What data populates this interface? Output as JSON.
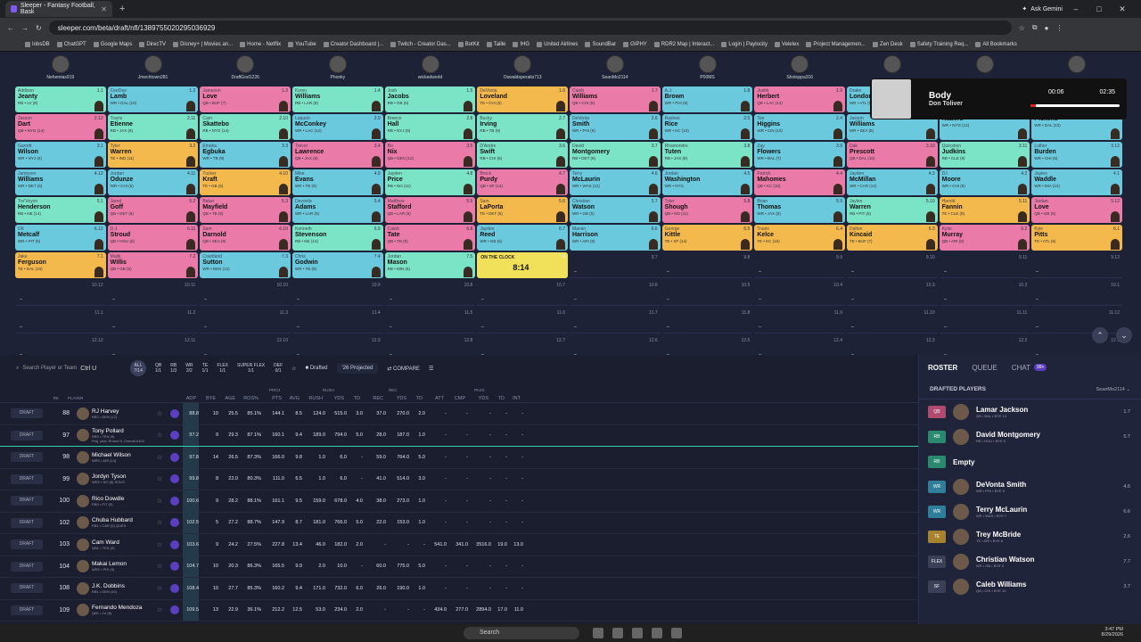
{
  "browser": {
    "tab_title": "Sleeper - Fantasy Football, Bask",
    "url": "sleeper.com/beta/draft/nfl/1389755020295036929",
    "ask_gemini": "Ask Gemini"
  },
  "bookmarks": [
    "IobsDB",
    "ChatGPT",
    "Google Maps",
    "DirecTV",
    "Disney+ | Movies an...",
    "Home - Netflix",
    "YouTube",
    "Creator Dashboard |...",
    "Twitch - Creator Das...",
    "BotKit",
    "Taille",
    "IHG",
    "United Airlines",
    "SoundBar",
    "GIPHY",
    "RDR2 Map | Interact...",
    "Login | Paylocity",
    "Velelex",
    "Project Managemen...",
    "Zen Desk",
    "Safety Training Req...",
    "All Bookmarks"
  ],
  "managers": [
    "Nehemias919",
    "Jmechtown281",
    "DraftGod1226",
    "Phonky",
    "wickedworld",
    "Oswaldoperalts713",
    "SeanMo2114",
    "P00MS",
    "Shotoppa316",
    "",
    "",
    ""
  ],
  "board": [
    [
      [
        "Addison",
        "Jeanty",
        "RB • LV (8)",
        "1.1",
        "RB"
      ],
      [
        "CeeDee",
        "Lamb",
        "WR • DAL (10)",
        "1.2",
        "WR"
      ],
      [
        "Jameson",
        "Love",
        "QB • BUF (7)",
        "1.3",
        "QB"
      ],
      [
        "Kyren",
        "Williams",
        "RB • LAR (8)",
        "1.4",
        "RB"
      ],
      [
        "Josh",
        "Jacobs",
        "RB • GB (5)",
        "1.5",
        "RB"
      ],
      [
        "DeVonta",
        "Loveland",
        "TE • CHI (5)",
        "1.6",
        "TE"
      ],
      [
        "Caleb",
        "Williams",
        "QB • CHI (5)",
        "1.7",
        "QB"
      ],
      [
        "A.J.",
        "Brown",
        "WR • PHI (9)",
        "1.8",
        "WR"
      ],
      [
        "Justin",
        "Herbert",
        "QB • LAC (12)",
        "1.9",
        "QB"
      ],
      [
        "Drake",
        "London",
        "WR • ATL (5)",
        "1.10",
        "WR"
      ],
      [
        "",
        "",
        "",
        "1.11",
        ""
      ],
      [
        "",
        "",
        "",
        "1.12",
        ""
      ]
    ],
    [
      [
        "Jaxson",
        "Dart",
        "QB • NYG (14)",
        "2.12",
        "QB"
      ],
      [
        "Travis",
        "Etienne",
        "RB • JAX (8)",
        "2.11",
        "RB"
      ],
      [
        "Cam",
        "Skattebo",
        "RB • NYG (14)",
        "2.10",
        "RB"
      ],
      [
        "Laquon",
        "McConkey",
        "WR • LAC (12)",
        "2.9",
        "WR"
      ],
      [
        "Breece",
        "Hall",
        "RB • NYJ (9)",
        "2.8",
        "RB"
      ],
      [
        "Bucky",
        "Irving",
        "RB • TB (9)",
        "2.7",
        "RB"
      ],
      [
        "DeVonta",
        "Smith",
        "WR • PHI (9)",
        "2.6",
        "WR"
      ],
      [
        "Rashee",
        "Rice",
        "WR • KC (10)",
        "2.5",
        "WR"
      ],
      [
        "Tee",
        "Higgins",
        "WR • CIN (10)",
        "2.4",
        "WR"
      ],
      [
        "Jaxson",
        "Williams",
        "WR • SEA (8)",
        "2.3",
        "WR"
      ],
      [
        "",
        "Nabers",
        "WR • NYG (14)",
        "2.2",
        "WR"
      ],
      [
        "",
        "Pickens",
        "WR • DAL (10)",
        "2.1",
        "WR"
      ]
    ],
    [
      [
        "Garrett",
        "Wilson",
        "WR • NYJ (9)",
        "3.1",
        "WR"
      ],
      [
        "Tyler",
        "Warren",
        "TE • IND (11)",
        "3.2",
        "TE"
      ],
      [
        "Emeka",
        "Egbuka",
        "WR • TB (9)",
        "3.3",
        "WR"
      ],
      [
        "Trevor",
        "Lawrence",
        "QB • JAX (8)",
        "3.4",
        "QB"
      ],
      [
        "Bo",
        "Nix",
        "QB • DEN (12)",
        "3.5",
        "QB"
      ],
      [
        "D'Andre",
        "Swift",
        "RB • CHI (5)",
        "3.6",
        "RB"
      ],
      [
        "David",
        "Montgomery",
        "RB • DET (8)",
        "3.7",
        "RB"
      ],
      [
        "Rhamondre",
        "Tuten",
        "RB • JAX (8)",
        "3.8",
        "RB"
      ],
      [
        "Zay",
        "Flowers",
        "WR • BAL (7)",
        "3.9",
        "WR"
      ],
      [
        "Dak",
        "Prescott",
        "QB • DAL (10)",
        "3.10",
        "QB"
      ],
      [
        "Quinshon",
        "Judkins",
        "RB • CLE (9)",
        "3.11",
        "RB"
      ],
      [
        "Luther",
        "Burden",
        "WR • CHI (5)",
        "3.12",
        "WR"
      ]
    ],
    [
      [
        "Jameson",
        "Williams",
        "WR • DET (8)",
        "4.12",
        "WR"
      ],
      [
        "Jordan",
        "Odunze",
        "WR • CHI (5)",
        "4.11",
        "WR"
      ],
      [
        "Tucker",
        "Kraft",
        "TE • GB (5)",
        "4.10",
        "TE"
      ],
      [
        "Mike",
        "Evans",
        "WR • TB (9)",
        "4.9",
        "WR"
      ],
      [
        "Jayden",
        "Price",
        "RB • NO (11)",
        "4.8",
        "RB"
      ],
      [
        "Brock",
        "Purdy",
        "QB • SF (14)",
        "4.7",
        "QB"
      ],
      [
        "Terry",
        "McLaurin",
        "WR • WAS (12)",
        "4.6",
        "WR"
      ],
      [
        "Jordan",
        "Washington",
        "WR • NYG",
        "4.5",
        "WR"
      ],
      [
        "Patrick",
        "Mahomes",
        "QB • KC (10)",
        "4.4",
        "QB"
      ],
      [
        "Jayden",
        "McMillan",
        "WR • CAR (14)",
        "4.3",
        "WR"
      ],
      [
        "DJ",
        "Moore",
        "WR • CHI (5)",
        "4.2",
        "WR"
      ],
      [
        "Jaylen",
        "Waddle",
        "WR • MIA (12)",
        "4.1",
        "WR"
      ]
    ],
    [
      [
        "Tre'Veyon",
        "Henderson",
        "RB • NE (14)",
        "5.1",
        "RB"
      ],
      [
        "Jared",
        "Goff",
        "QB • DET (8)",
        "5.2",
        "QB"
      ],
      [
        "Baker",
        "Mayfield",
        "QB • TB (9)",
        "5.3",
        "QB"
      ],
      [
        "Devonta",
        "Adams",
        "WR • LAR (8)",
        "5.4",
        "WR"
      ],
      [
        "Matthew",
        "Stafford",
        "QB • LAR (8)",
        "5.5",
        "QB"
      ],
      [
        "Sam",
        "LaPorta",
        "TE • DET (8)",
        "5.6",
        "TE"
      ],
      [
        "Christian",
        "Watson",
        "WR • GB (5)",
        "5.7",
        "WR"
      ],
      [
        "Tyler",
        "Shough",
        "QB • NO (11)",
        "5.8",
        "QB"
      ],
      [
        "Brian",
        "Thomas",
        "WR • JAX (8)",
        "5.9",
        "WR"
      ],
      [
        "Jaylen",
        "Warren",
        "RB • PIT (5)",
        "5.10",
        "RB"
      ],
      [
        "Harold",
        "Fannin",
        "TE • CLE (9)",
        "5.11",
        "TE"
      ],
      [
        "Jordan",
        "Love",
        "QB • GB (5)",
        "5.12",
        "QB"
      ]
    ],
    [
      [
        "DK",
        "Metcalf",
        "WR • PIT (5)",
        "6.12",
        "WR"
      ],
      [
        "D.J.",
        "Stroud",
        "QB • HOU (6)",
        "6.11",
        "QB"
      ],
      [
        "Sam",
        "Darnold",
        "QB • SEA (8)",
        "6.10",
        "QB"
      ],
      [
        "Kenneth",
        "Stevenson",
        "RB • NE (14)",
        "6.9",
        "RB"
      ],
      [
        "Caleb",
        "Tate",
        "QB • TB (9)",
        "6.8",
        "QB"
      ],
      [
        "Jayden",
        "Reed",
        "WR • GB (5)",
        "6.7",
        "WR"
      ],
      [
        "Marvin",
        "Harrison",
        "WR • ARI (8)",
        "6.6",
        "WR"
      ],
      [
        "George",
        "Kittle",
        "TE • SF (14)",
        "6.5",
        "TE"
      ],
      [
        "Travis",
        "Kelce",
        "TE • KC (10)",
        "6.4",
        "TE"
      ],
      [
        "Dalton",
        "Kincaid",
        "TE • BUF (7)",
        "6.3",
        "TE"
      ],
      [
        "Kyler",
        "Murray",
        "QB • ARI (8)",
        "6.2",
        "QB"
      ],
      [
        "Kyle",
        "Pitts",
        "TE • ATL (5)",
        "6.1",
        "TE"
      ]
    ],
    [
      [
        "Jake",
        "Ferguson",
        "TE • DAL (10)",
        "7.1",
        "TE"
      ],
      [
        "Malik",
        "Willis",
        "QB • GB (5)",
        "7.2",
        "QB"
      ],
      [
        "Courtland",
        "Sutton",
        "WR • DEN (12)",
        "7.3",
        "WR"
      ],
      [
        "Chris",
        "Godwin",
        "WR • TB (9)",
        "7.4",
        "WR"
      ],
      [
        "Jordan",
        "Mason",
        "RB • MIN (6)",
        "7.5",
        "RB"
      ],
      [
        "OTC",
        "",
        "",
        "7.6",
        ""
      ],
      [
        "",
        "",
        "",
        "9.7",
        ""
      ],
      [
        "",
        "",
        "",
        "9.8",
        ""
      ],
      [
        "",
        "",
        "",
        "9.9",
        ""
      ],
      [
        "",
        "",
        "",
        "9.10",
        ""
      ],
      [
        "",
        "",
        "",
        "9.11",
        ""
      ],
      [
        "",
        "",
        "",
        "9.12",
        ""
      ]
    ]
  ],
  "empty_rows": [
    [
      "10.12",
      "10.11",
      "10.10",
      "10.9",
      "10.8",
      "10.7",
      "10.6",
      "10.5",
      "10.4",
      "10.3",
      "10.2",
      "10.1"
    ],
    [
      "11.1",
      "11.2",
      "11.3",
      "11.4",
      "11.5",
      "11.6",
      "11.7",
      "11.8",
      "11.9",
      "11.10",
      "11.11",
      "11.12"
    ],
    [
      "12.12",
      "12.11",
      "12.10",
      "12.9",
      "12.8",
      "12.7",
      "12.6",
      "12.5",
      "12.4",
      "12.3",
      "12.2",
      "12.1"
    ]
  ],
  "otc": {
    "label": "ON THE CLOCK",
    "timer": "8:14"
  },
  "music": {
    "song": "Body",
    "artist": "Don Toliver",
    "elapsed": "00:06",
    "total": "02:35"
  },
  "filters": {
    "search_placeholder": "Search Player or Team",
    "shortcut": "Ctrl U",
    "positions": [
      [
        "ALL",
        "7/14"
      ],
      [
        "QB",
        "1/1"
      ],
      [
        "RB",
        "1/3"
      ],
      [
        "WR",
        "2/2"
      ],
      [
        "TE",
        "1/1"
      ],
      [
        "FLEX",
        "1/1"
      ],
      [
        "SUPER FLEX",
        "1/1"
      ],
      [
        "DEF",
        "0/1"
      ]
    ],
    "drafted": "Drafted",
    "projected": "'26 Projected",
    "compare": "COMPARE"
  },
  "table_groups": {
    "proj": "PROJ",
    "rush": "RUSH",
    "rec": "REC",
    "pass": "PASS"
  },
  "columns": [
    "RK",
    "PLAYER",
    "ADP",
    "BYE",
    "AGE",
    "ROS%",
    "PTS",
    "AVG",
    "RUSH",
    "YDS",
    "TD",
    "REC",
    "YDS",
    "TD",
    "ATT",
    "CMP",
    "YDS",
    "TD",
    "INT"
  ],
  "players": [
    {
      "rk": "88",
      "name": "RJ Harvey",
      "sub": "RB2 • DEN (12)",
      "vals": [
        "88.8",
        "10",
        "25.5",
        "85.1%",
        "144.1",
        "8.5",
        "124.0",
        "515.0",
        "3.0",
        "37.0",
        "270.0",
        "2.0",
        "-",
        "-",
        "-",
        "-",
        "-"
      ]
    },
    {
      "rk": "97",
      "name": "Tony Pollard",
      "sub": "RB3 • TEN (9)",
      "note": "Proj. pick: Round 9, Overall #103",
      "vals": [
        "97.2",
        "9",
        "29.3",
        "87.1%",
        "160.1",
        "9.4",
        "189.0",
        "794.0",
        "5.0",
        "28.0",
        "187.0",
        "1.0",
        "-",
        "-",
        "-",
        "-",
        "-"
      ]
    },
    {
      "rk": "98",
      "name": "Michael Wilson",
      "sub": "WR3 • ARI (14)",
      "vals": [
        "97.8",
        "14",
        "26.5",
        "87.3%",
        "166.0",
        "9.8",
        "1.0",
        "6.0",
        "-",
        "59.0",
        "764.0",
        "5.0",
        "-",
        "-",
        "-",
        "-",
        "-"
      ]
    },
    {
      "rk": "99",
      "name": "Jordyn Tyson",
      "sub": "WR2 • NO (8) SOUS",
      "vals": [
        "99.8",
        "8",
        "22.0",
        "80.3%",
        "111.0",
        "6.5",
        "1.0",
        "6.0",
        "-",
        "41.0",
        "514.0",
        "3.0",
        "-",
        "-",
        "-",
        "-",
        "-"
      ]
    },
    {
      "rk": "100",
      "name": "Rico Dowdle",
      "sub": "RB3 • PIT (9)",
      "vals": [
        "100.6",
        "9",
        "28.2",
        "88.1%",
        "161.1",
        "9.5",
        "159.0",
        "678.0",
        "4.0",
        "38.0",
        "273.0",
        "1.0",
        "-",
        "-",
        "-",
        "-",
        "-"
      ]
    },
    {
      "rk": "102",
      "name": "Chuba Hubbard",
      "sub": "RB1 • CAR (5) QUES",
      "vals": [
        "102.5",
        "5",
        "27.2",
        "88.7%",
        "147.9",
        "8.7",
        "181.0",
        "766.0",
        "5.0",
        "22.0",
        "153.0",
        "1.0",
        "-",
        "-",
        "-",
        "-",
        "-"
      ]
    },
    {
      "rk": "103",
      "name": "Cam Ward",
      "sub": "QB1 • TEN (9)",
      "vals": [
        "103.6",
        "9",
        "24.2",
        "27.5%",
        "227.8",
        "13.4",
        "46.0",
        "182.0",
        "2.0",
        "-",
        "-",
        "-",
        "541.0",
        "341.0",
        "3516.0",
        "19.0",
        "13.0"
      ]
    },
    {
      "rk": "104",
      "name": "Makai Lemon",
      "sub": "WR2 • PHI (9)",
      "vals": [
        "104.7",
        "10",
        "20.3",
        "86.3%",
        "165.5",
        "9.9",
        "2.0",
        "10.0",
        "-",
        "60.0",
        "775.0",
        "5.0",
        "-",
        "-",
        "-",
        "-",
        "-"
      ]
    },
    {
      "rk": "108",
      "name": "J.K. Dobbins",
      "sub": "RB1 • DEN (10)",
      "vals": [
        "108.4",
        "10",
        "27.7",
        "85.3%",
        "160.2",
        "9.4",
        "171.0",
        "732.0",
        "6.0",
        "26.0",
        "190.0",
        "1.0",
        "-",
        "-",
        "-",
        "-",
        "-"
      ]
    },
    {
      "rk": "109",
      "name": "Fernando Mendoza",
      "sub": "QB1 • LV (8)",
      "vals": [
        "109.5",
        "13",
        "22.9",
        "36.1%",
        "212.2",
        "12.5",
        "53.0",
        "234.0",
        "2.0",
        "-",
        "-",
        "-",
        "434.0",
        "277.0",
        "2894.0",
        "17.0",
        "11.0"
      ]
    }
  ],
  "draft_label": "DRAFT",
  "side": {
    "tabs": [
      "ROSTER",
      "QUEUE",
      "CHAT"
    ],
    "chat_badge": "99+",
    "heading": "DRAFTED PLAYERS",
    "manager": "SeanMo2114",
    "roster": [
      {
        "pos": "QB",
        "name": "Lamar Jackson",
        "sub": "QB • BAL • BYE 13",
        "val": "1.7",
        "color": "#b04a6e"
      },
      {
        "pos": "RB",
        "name": "David Montgomery",
        "sub": "RB • HOU • BYE 6",
        "val": "5.7",
        "color": "#2a8a70"
      },
      {
        "pos": "RB",
        "name": "Empty",
        "sub": "",
        "val": "",
        "color": "#2a8a70"
      },
      {
        "pos": "WR",
        "name": "DeVonta Smith",
        "sub": "WR • PHI • BYE 9",
        "val": "4.6",
        "color": "#2f7f9a"
      },
      {
        "pos": "WR",
        "name": "Terry McLaurin",
        "sub": "WR • WAS • BYE 7",
        "val": "6.6",
        "color": "#2f7f9a"
      },
      {
        "pos": "TE",
        "name": "Trey McBride",
        "sub": "TE • ARI • BYE 8",
        "val": "2.6",
        "color": "#a8822e"
      },
      {
        "pos": "FLEX",
        "name": "Christian Watson",
        "sub": "WR • GB • BYE 5",
        "val": "7.7",
        "color": "#3b4058"
      },
      {
        "pos": "SF",
        "name": "Caleb Williams",
        "sub": "QB • CHI • BYE 10",
        "val": "3.7",
        "color": "#3b4058"
      }
    ]
  },
  "taskbar": {
    "search": "Search",
    "time": "3:47 PM",
    "date": "8/29/2026"
  }
}
